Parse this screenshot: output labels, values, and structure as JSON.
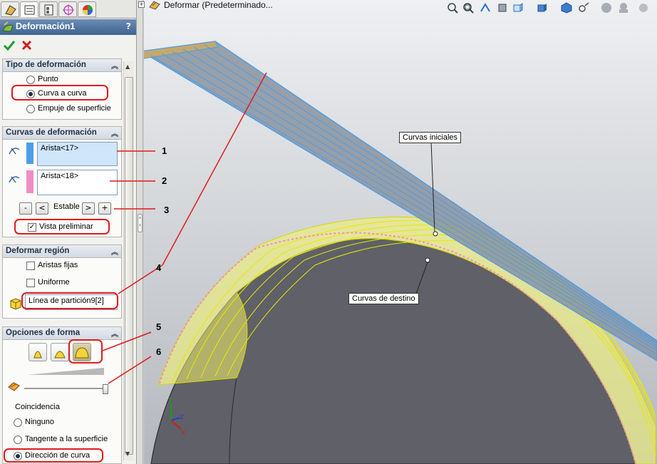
{
  "window": {
    "feature_title": "Deformación1",
    "help": "?",
    "tree_label": "Deformar  (Predeterminado..."
  },
  "groups": {
    "deform_type": {
      "title": "Tipo de deformación",
      "options": [
        "Punto",
        "Curva a curva",
        "Empuje de superficie"
      ],
      "selected": "Curva a curva"
    },
    "deform_curves": {
      "title": "Curvas de deformación",
      "initial_curve": "Arista<17>",
      "target_curve": "Arista<18>",
      "step_label": "Estable",
      "minus": "-",
      "prev": "<",
      "next": ">",
      "plus": "+",
      "preview_label": "Vista preliminar",
      "preview_checked": true
    },
    "deform_region": {
      "title": "Deformar región",
      "fixed_edges": "Aristas fijas",
      "uniform": "Uniforme",
      "face_selection": "Línea de partición9[2]"
    },
    "shape_options": {
      "title": "Opciones de forma",
      "slider_value_percent": 100,
      "coincidence_label": "Coincidencia",
      "options": [
        "Ninguno",
        "Tangente a la superficie",
        "Dirección de curva"
      ],
      "selected": "Dirección de curva"
    }
  },
  "annotations": [
    "1",
    "2",
    "3",
    "4",
    "5",
    "6"
  ],
  "callouts": {
    "initial": "Curvas iniciales",
    "target": "Curvas de destino"
  },
  "colors": {
    "initial_curve": "#4e9de6",
    "target_curve": "#f08cc5",
    "highlight": "#e01b1b",
    "preview_yellow": "#f4f46a",
    "body_gray": "#5f6068",
    "background_top": "#e9eaec",
    "background_bottom": "#b9bdc3"
  },
  "icons": [
    "sketch-icon",
    "property-manager-icon",
    "configuration-icon",
    "target-icon",
    "appearance-icon",
    "deform-icon",
    "ok-icon",
    "cancel-icon",
    "curve-select-icon",
    "face-icon",
    "shape-stiffness-icon",
    "triad-icon"
  ]
}
